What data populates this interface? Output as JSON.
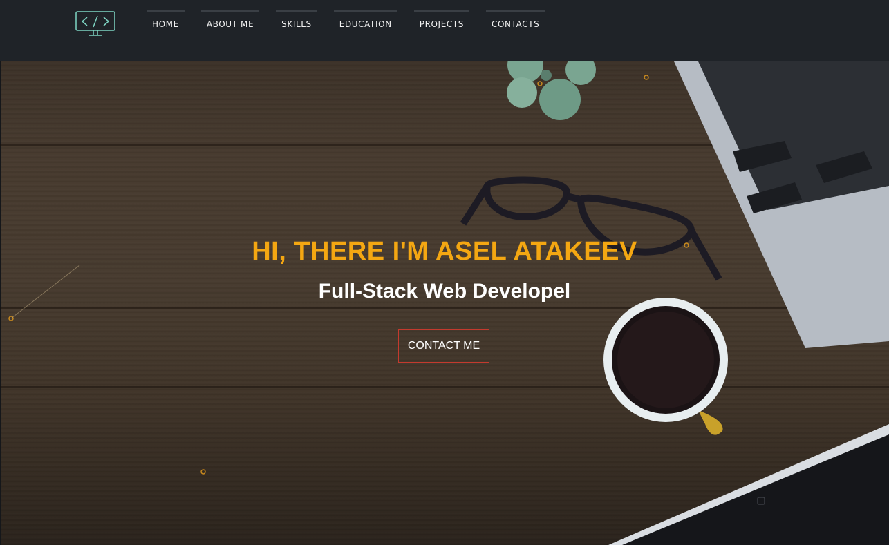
{
  "header": {
    "logo_icon": "code-monitor-icon",
    "nav": [
      {
        "label": "HOME"
      },
      {
        "label": "ABOUT ME"
      },
      {
        "label": "SKILLS"
      },
      {
        "label": "EDUCATION"
      },
      {
        "label": "PROJECTS"
      },
      {
        "label": "CONTACTS"
      }
    ]
  },
  "hero": {
    "title": "HI, THERE I'M ASEL ATAKEEV",
    "subtitle": "Full-Stack Web Developel",
    "cta_label": "CONTACT ME"
  },
  "colors": {
    "header_bg": "#1f2328",
    "accent": "#f4a712",
    "cta_border": "#c43a2e",
    "logo": "#7fd6c4"
  }
}
